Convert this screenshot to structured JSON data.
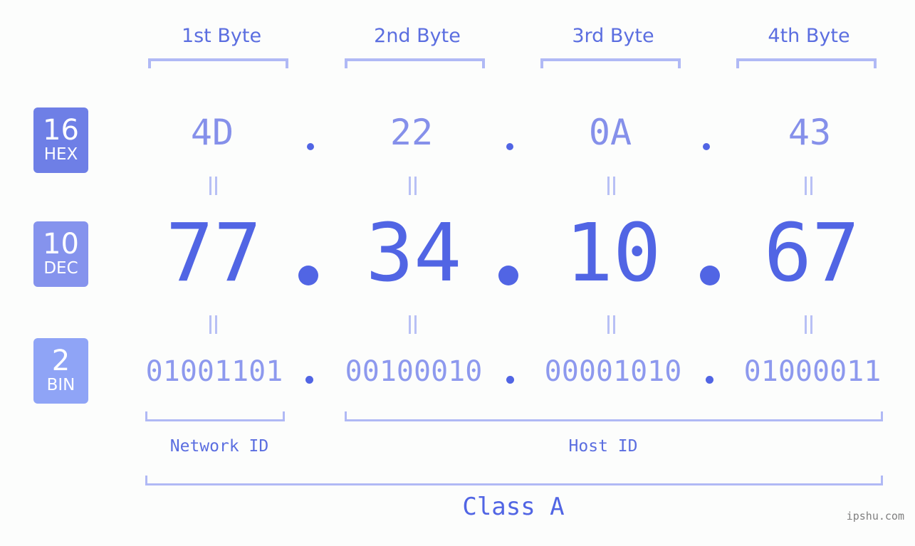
{
  "row_labels": [
    {
      "num": "16",
      "label": "HEX",
      "color": "#6e7fe6"
    },
    {
      "num": "10",
      "label": "DEC",
      "color": "#8593ed"
    },
    {
      "num": "2",
      "label": "BIN",
      "color": "#8fa4f6"
    }
  ],
  "byte_headers": [
    "1st Byte",
    "2nd Byte",
    "3rd Byte",
    "4th Byte"
  ],
  "hex": [
    "4D",
    "22",
    "0A",
    "43"
  ],
  "dec": [
    "77",
    "34",
    "10",
    "67"
  ],
  "bin": [
    "01001101",
    "00100010",
    "00001010",
    "01000011"
  ],
  "network_id_label": "Network ID",
  "host_id_label": "Host ID",
  "class_label": "Class A",
  "watermark": "ipshu.com",
  "colors": {
    "accent": "#5165e4",
    "bracket": "#b0b9f5"
  }
}
